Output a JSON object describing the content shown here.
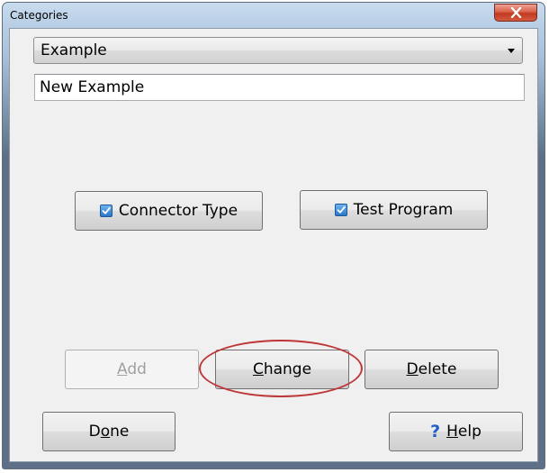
{
  "window": {
    "title": "Categories",
    "close_icon": "close-icon"
  },
  "category_select": {
    "selected": "Example"
  },
  "name_field": {
    "value": "New Example"
  },
  "toggles": {
    "connector_type": {
      "label": "Connector Type",
      "checked": true
    },
    "test_program": {
      "label": "Test Program",
      "checked": true
    }
  },
  "actions": {
    "add": {
      "pre": "",
      "key": "A",
      "post": "dd",
      "enabled": false
    },
    "change": {
      "pre": "",
      "key": "C",
      "post": "hange",
      "enabled": true
    },
    "delete": {
      "pre": "",
      "key": "D",
      "post": "elete",
      "enabled": true
    },
    "done": {
      "pre": "D",
      "key": "o",
      "post": "ne",
      "enabled": true
    },
    "help": {
      "pre": "",
      "key": "H",
      "post": "elp",
      "icon": "question-icon",
      "icon_glyph": "?"
    }
  },
  "annotation": {
    "highlight_color": "#c0373a",
    "highlight_target": "Change"
  }
}
